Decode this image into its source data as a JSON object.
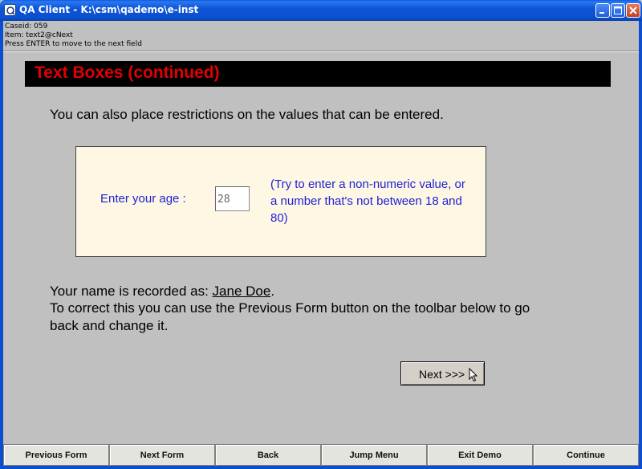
{
  "window": {
    "title": "QA Client - K:\\csm\\qademo\\e-inst",
    "icon": "app-icon"
  },
  "status": {
    "caseid": "Caseid: 059",
    "item": "Item: text2@cNext",
    "instruction": "Press ENTER to move to the next field"
  },
  "heading": "Text Boxes (continued)",
  "intro": "You can also place restrictions on the values that can be entered.",
  "age": {
    "label": "Enter your age :",
    "value": "28",
    "hint": "(Try to enter a non-numeric value, or a number that's not between 18 and 80)"
  },
  "name_record": {
    "prefix": "Your name is recorded as: ",
    "value": "Jane Doe",
    "suffix": "."
  },
  "correction": "To correct this you can use the Previous Form button on the toolbar below to go back and change it.",
  "next_button": "Next >>>",
  "toolbar": [
    "Previous Form",
    "Next Form",
    "Back",
    "Jump Menu",
    "Exit Demo",
    "Continue"
  ],
  "colors": {
    "titlebar": "#0b4fcf",
    "heading_text": "#e00000",
    "prompt_text": "#1f1fd6",
    "panel_bg": "#fdf7e3"
  }
}
